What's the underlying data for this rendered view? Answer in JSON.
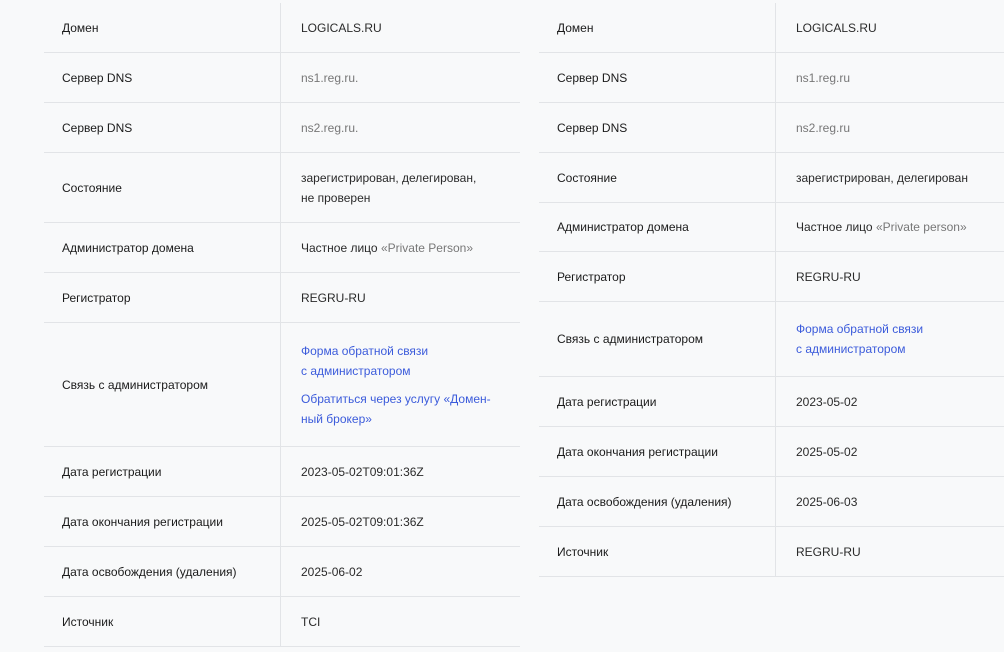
{
  "left": {
    "domain_label": "Домен",
    "domain_value": "LOGICALS.RU",
    "dns1_label": "Сервер DNS",
    "dns1_value": "ns1.reg.ru.",
    "dns2_label": "Сервер DNS",
    "dns2_value": "ns2.reg.ru.",
    "state_label": "Состояние",
    "state_value_line1": "зарегистрирован, делегирован,",
    "state_value_line2": "не проверен",
    "admin_label": "Администратор домена",
    "admin_value_prefix": "Частное лицо ",
    "admin_value_name": "«Private Person»",
    "registrar_label": "Регистратор",
    "registrar_value": "REGRU-RU",
    "contact_label": "Связь с администратором",
    "contact_link1_line1": "Форма обратной связи",
    "contact_link1_line2": "с администратором",
    "contact_link2_line1": "Обратиться через услугу «Домен-",
    "contact_link2_line2": "ный брокер»",
    "reg_date_label": "Дата регистрации",
    "reg_date_value": "2023-05-02T09:01:36Z",
    "exp_date_label": "Дата окончания регистрации",
    "exp_date_value": "2025-05-02T09:01:36Z",
    "free_date_label": "Дата освобождения (удаления)",
    "free_date_value": "2025-06-02",
    "source_label": "Источник",
    "source_value": "TCI"
  },
  "right": {
    "domain_label": "Домен",
    "domain_value": "LOGICALS.RU",
    "dns1_label": "Сервер DNS",
    "dns1_value": "ns1.reg.ru",
    "dns2_label": "Сервер DNS",
    "dns2_value": "ns2.reg.ru",
    "state_label": "Состояние",
    "state_value": "зарегистрирован, делегирован",
    "admin_label": "Администратор домена",
    "admin_value_prefix": "Частное лицо ",
    "admin_value_name": "«Private person»",
    "registrar_label": "Регистратор",
    "registrar_value": "REGRU-RU",
    "contact_label": "Связь с администратором",
    "contact_link1_line1": "Форма обратной связи",
    "contact_link1_line2": "с администратором",
    "reg_date_label": "Дата регистрации",
    "reg_date_value": "2023-05-02",
    "exp_date_label": "Дата окончания регистрации",
    "exp_date_value": "2025-05-02",
    "free_date_label": "Дата освобождения (удаления)",
    "free_date_value": "2025-06-03",
    "source_label": "Источник",
    "source_value": "REGRU-RU"
  }
}
